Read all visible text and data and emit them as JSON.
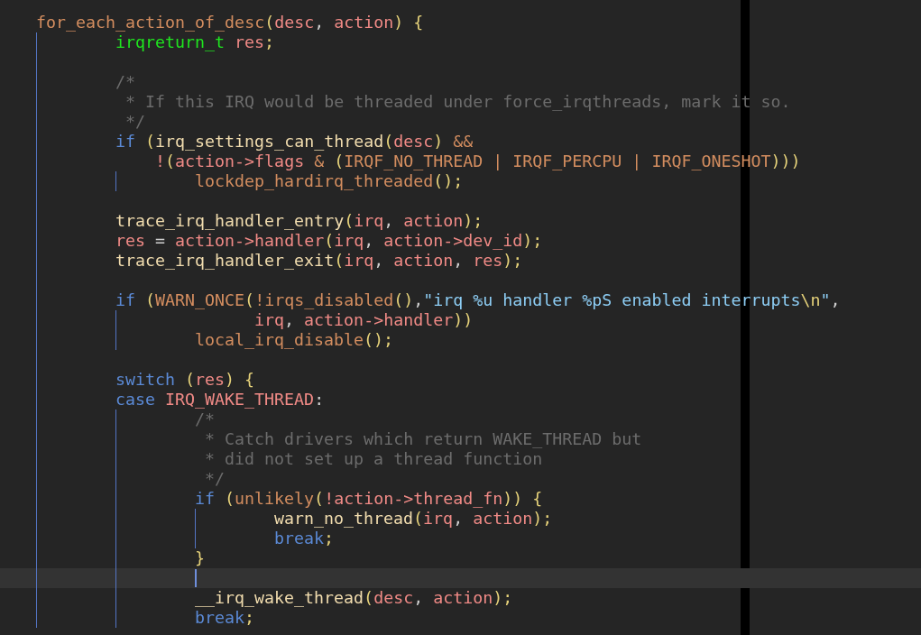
{
  "editor": {
    "lines": [
      {
        "current": false,
        "segments": [
          {
            "kind": "function",
            "text": "for_each_action_of_desc"
          },
          {
            "kind": "punctuation",
            "text": "("
          },
          {
            "kind": "variable",
            "text": "desc"
          },
          {
            "kind": "plain",
            "text": ", "
          },
          {
            "kind": "variable",
            "text": "action"
          },
          {
            "kind": "punctuation",
            "text": ") {"
          }
        ]
      },
      {
        "current": false,
        "segments": [
          {
            "kind": "type",
            "text": "\tirqreturn_t "
          },
          {
            "kind": "variable",
            "text": "res"
          },
          {
            "kind": "punctuation",
            "text": ";"
          }
        ]
      },
      {
        "current": false
      },
      {
        "current": false,
        "segments": [
          {
            "kind": "comment",
            "text": "\t/*"
          }
        ]
      },
      {
        "current": false,
        "segments": [
          {
            "kind": "comment",
            "text": "\t * If this IRQ would be threaded under force_irqthreads, mark it so."
          }
        ]
      },
      {
        "current": false,
        "segments": [
          {
            "kind": "comment",
            "text": "\t */"
          }
        ]
      },
      {
        "current": false,
        "segments": [
          {
            "kind": "keyword",
            "text": "\tif "
          },
          {
            "kind": "punctuation",
            "text": "("
          },
          {
            "kind": "call",
            "text": "irq_settings_can_thread"
          },
          {
            "kind": "punctuation",
            "text": "("
          },
          {
            "kind": "variable",
            "text": "desc"
          },
          {
            "kind": "punctuation",
            "text": ") "
          },
          {
            "kind": "function",
            "text": "&&"
          }
        ]
      },
      {
        "current": false,
        "segments": [
          {
            "kind": "variable",
            "text": "\t    !"
          },
          {
            "kind": "punctuation",
            "text": "("
          },
          {
            "kind": "variable",
            "text": "action->flags "
          },
          {
            "kind": "function",
            "text": "& "
          },
          {
            "kind": "punctuation",
            "text": "("
          },
          {
            "kind": "function",
            "text": "IRQF_NO_THREAD | IRQF_PERCPU | IRQF_ONESHOT"
          },
          {
            "kind": "punctuation",
            "text": ")))"
          }
        ]
      },
      {
        "current": false,
        "segments": [
          {
            "kind": "function",
            "text": "\t\tlockdep_hardirq_threaded"
          },
          {
            "kind": "punctuation",
            "text": "();"
          }
        ]
      },
      {
        "current": false
      },
      {
        "current": false,
        "segments": [
          {
            "kind": "call",
            "text": "\ttrace_irq_handler_entry"
          },
          {
            "kind": "punctuation",
            "text": "("
          },
          {
            "kind": "variable",
            "text": "irq"
          },
          {
            "kind": "plain",
            "text": ", "
          },
          {
            "kind": "variable",
            "text": "action"
          },
          {
            "kind": "punctuation",
            "text": ");"
          }
        ]
      },
      {
        "current": false,
        "segments": [
          {
            "kind": "variable",
            "text": "\tres"
          },
          {
            "kind": "plain",
            "text": " = "
          },
          {
            "kind": "variable",
            "text": "action->handler"
          },
          {
            "kind": "punctuation",
            "text": "("
          },
          {
            "kind": "variable",
            "text": "irq"
          },
          {
            "kind": "plain",
            "text": ", "
          },
          {
            "kind": "variable",
            "text": "action->dev_id"
          },
          {
            "kind": "punctuation",
            "text": ");"
          }
        ]
      },
      {
        "current": false,
        "segments": [
          {
            "kind": "call",
            "text": "\ttrace_irq_handler_exit"
          },
          {
            "kind": "punctuation",
            "text": "("
          },
          {
            "kind": "variable",
            "text": "irq"
          },
          {
            "kind": "plain",
            "text": ", "
          },
          {
            "kind": "variable",
            "text": "action"
          },
          {
            "kind": "plain",
            "text": ", "
          },
          {
            "kind": "variable",
            "text": "res"
          },
          {
            "kind": "punctuation",
            "text": ");"
          }
        ]
      },
      {
        "current": false
      },
      {
        "current": false,
        "segments": [
          {
            "kind": "keyword",
            "text": "\tif "
          },
          {
            "kind": "punctuation",
            "text": "("
          },
          {
            "kind": "function",
            "text": "WARN_ONCE"
          },
          {
            "kind": "punctuation",
            "text": "("
          },
          {
            "kind": "function",
            "text": "!irqs_disabled"
          },
          {
            "kind": "punctuation",
            "text": "()"
          },
          {
            "kind": "plain",
            "text": ","
          },
          {
            "kind": "string",
            "text": "\"irq %u handler %pS enabled interrupts"
          },
          {
            "kind": "punctuation",
            "text": "\\n"
          },
          {
            "kind": "string",
            "text": "\""
          },
          {
            "kind": "plain",
            "text": ","
          }
        ]
      },
      {
        "current": false,
        "segments": [
          {
            "kind": "variable",
            "text": "\t\t      irq"
          },
          {
            "kind": "plain",
            "text": ", "
          },
          {
            "kind": "variable",
            "text": "action->handler"
          },
          {
            "kind": "punctuation",
            "text": "))"
          }
        ]
      },
      {
        "current": false,
        "segments": [
          {
            "kind": "function",
            "text": "\t\tlocal_irq_disable"
          },
          {
            "kind": "punctuation",
            "text": "();"
          }
        ]
      },
      {
        "current": false
      },
      {
        "current": false,
        "segments": [
          {
            "kind": "keyword",
            "text": "\tswitch "
          },
          {
            "kind": "punctuation",
            "text": "("
          },
          {
            "kind": "variable",
            "text": "res"
          },
          {
            "kind": "punctuation",
            "text": ") {"
          }
        ]
      },
      {
        "current": false,
        "segments": [
          {
            "kind": "keyword",
            "text": "\tcase "
          },
          {
            "kind": "variable",
            "text": "IRQ_WAKE_THREAD"
          },
          {
            "kind": "plain",
            "text": ":"
          }
        ]
      },
      {
        "current": false,
        "segments": [
          {
            "kind": "comment",
            "text": "\t\t/*"
          }
        ]
      },
      {
        "current": false,
        "segments": [
          {
            "kind": "comment",
            "text": "\t\t * Catch drivers which return WAKE_THREAD but"
          }
        ]
      },
      {
        "current": false,
        "segments": [
          {
            "kind": "comment",
            "text": "\t\t * did not set up a thread function"
          }
        ]
      },
      {
        "current": false,
        "segments": [
          {
            "kind": "comment",
            "text": "\t\t */"
          }
        ]
      },
      {
        "current": false,
        "segments": [
          {
            "kind": "keyword",
            "text": "\t\tif "
          },
          {
            "kind": "punctuation",
            "text": "("
          },
          {
            "kind": "function",
            "text": "unlikely"
          },
          {
            "kind": "punctuation",
            "text": "("
          },
          {
            "kind": "variable",
            "text": "!action->thread_fn"
          },
          {
            "kind": "punctuation",
            "text": ")) {"
          }
        ]
      },
      {
        "current": false,
        "segments": [
          {
            "kind": "call",
            "text": "\t\t\twarn_no_thread"
          },
          {
            "kind": "punctuation",
            "text": "("
          },
          {
            "kind": "variable",
            "text": "irq"
          },
          {
            "kind": "plain",
            "text": ", "
          },
          {
            "kind": "variable",
            "text": "action"
          },
          {
            "kind": "punctuation",
            "text": ");"
          }
        ]
      },
      {
        "current": false,
        "segments": [
          {
            "kind": "keyword",
            "text": "\t\t\tbreak"
          },
          {
            "kind": "punctuation",
            "text": ";"
          }
        ]
      },
      {
        "current": false,
        "segments": [
          {
            "kind": "punctuation",
            "text": "\t\t}"
          }
        ]
      },
      {
        "current": true
      },
      {
        "current": false,
        "segments": [
          {
            "kind": "call",
            "text": "\t\t__irq_wake_thread"
          },
          {
            "kind": "punctuation",
            "text": "("
          },
          {
            "kind": "variable",
            "text": "desc"
          },
          {
            "kind": "plain",
            "text": ", "
          },
          {
            "kind": "variable",
            "text": "action"
          },
          {
            "kind": "punctuation",
            "text": ");"
          }
        ]
      },
      {
        "current": false,
        "segments": [
          {
            "kind": "keyword",
            "text": "\t\tbreak"
          },
          {
            "kind": "punctuation",
            "text": ";"
          }
        ]
      }
    ]
  }
}
